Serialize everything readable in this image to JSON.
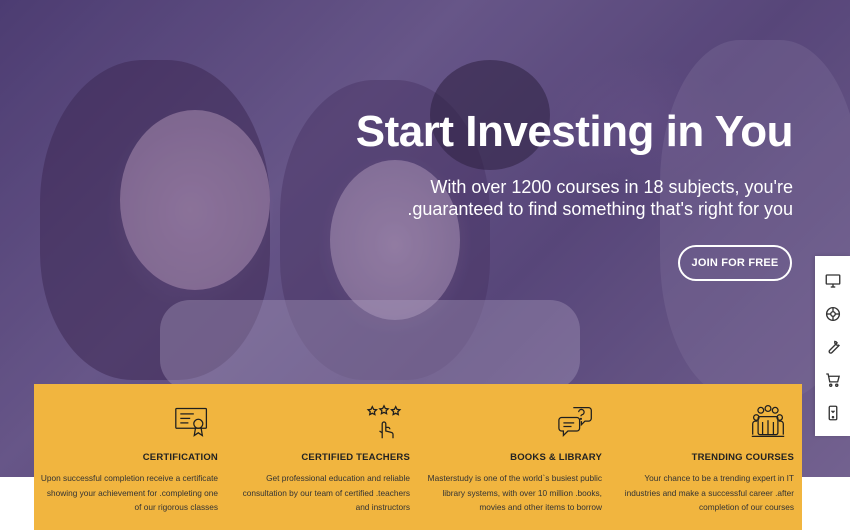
{
  "hero": {
    "headline": "Start Investing in You",
    "subtitle_line1": "With over 1200 courses in 18 subjects, you're",
    "subtitle_line2": ".guaranteed to find something that's right for you",
    "cta_label": "JOIN FOR FREE"
  },
  "sidebar": {
    "items": [
      {
        "icon": "monitor-icon"
      },
      {
        "icon": "globe-icon"
      },
      {
        "icon": "wrench-icon"
      },
      {
        "icon": "cart-icon"
      },
      {
        "icon": "mobile-icon"
      }
    ]
  },
  "features": [
    {
      "icon": "certificate-icon",
      "title": "CERTIFICATION",
      "desc": "Upon successful completion receive a certificate showing your achievement for .completing one of our rigorous classes"
    },
    {
      "icon": "rating-hand-icon",
      "title": "CERTIFIED TEACHERS",
      "desc": "Get professional education and reliable consultation by our team of certified .teachers and instructors"
    },
    {
      "icon": "chat-question-icon",
      "title": "BOOKS & LIBRARY",
      "desc": "Masterstudy is one of the world`s busiest public library systems, with over 10 million .books, movies and other items to borrow"
    },
    {
      "icon": "group-icon",
      "title": "TRENDING COURSES",
      "desc": "Your chance to be a trending expert in IT industries and make a successful career .after completion of our courses"
    }
  ],
  "colors": {
    "panel": "#f1b53f",
    "hero_overlay": "#5b4b7c",
    "text_light": "#ffffff",
    "text_dark": "#222222"
  }
}
